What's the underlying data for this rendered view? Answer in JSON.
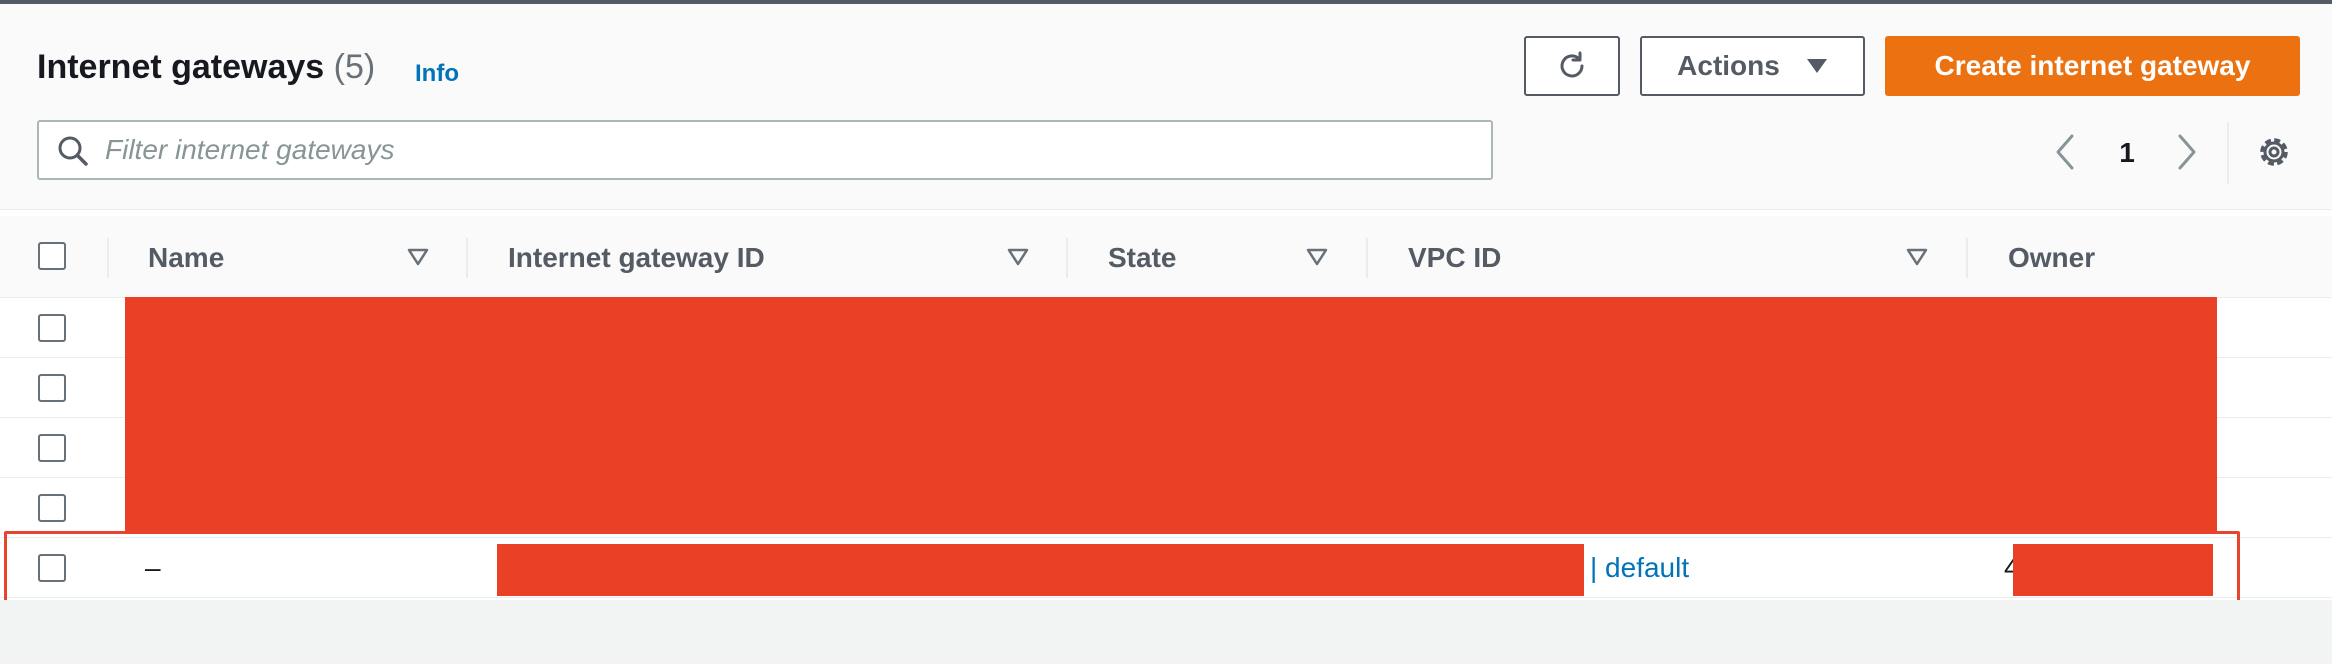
{
  "header": {
    "title": "Internet gateways",
    "count": "(5)",
    "info_label": "Info",
    "actions_label": "Actions",
    "create_label": "Create internet gateway"
  },
  "search": {
    "placeholder": "Filter internet gateways"
  },
  "pagination": {
    "current_page": "1"
  },
  "table": {
    "columns": [
      "Name",
      "Internet gateway ID",
      "State",
      "VPC ID",
      "Owner"
    ],
    "visible_row": {
      "name": "–",
      "vpc_suffix": "| default",
      "owner_prefix": "4"
    }
  },
  "colors": {
    "accent_orange": "#ec7211",
    "link_blue": "#0073bb",
    "redaction_red": "#ea4026"
  },
  "icons": [
    "refresh-icon",
    "caret-down-icon",
    "search-icon",
    "chevron-left-icon",
    "chevron-right-icon",
    "gear-icon",
    "sort-icon"
  ]
}
